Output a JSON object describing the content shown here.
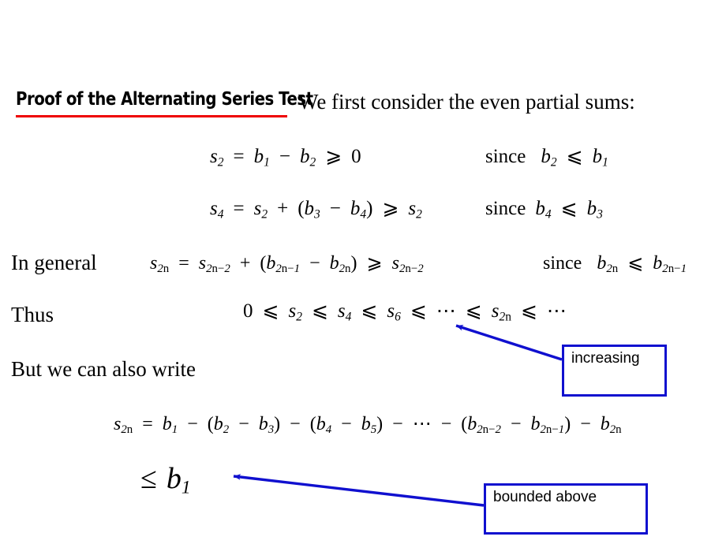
{
  "slide": {
    "title": "Proof of the Alternating Series Test",
    "intro": "We first consider the even partial sums:"
  },
  "lines": {
    "eq1": "s₂ = b₁ − b₂ ⩾ 0",
    "eq1_since": "since  b₂ ⩽ b₁",
    "eq2": "s₄ = s₂ + (b₃ − b₄) ⩾ s₂",
    "eq2_since": "since b₄ ⩽ b₃",
    "in_general_label": "In general",
    "eq3": "s₂ₙ = s₂ₙ₋₂ + (b₂ₙ₋₁ − b₂ₙ) ⩾ s₂ₙ₋₂",
    "eq3_since": "since  b₂ₙ ⩽ b₂ₙ₋₁",
    "thus_label": "Thus",
    "eq4": "0 ⩽ s₂ ⩽ s₄ ⩽ s₆ ⩽ ⋯ ⩽ s₂ₙ ⩽ ⋯",
    "but_label": "But we can also write",
    "eq5": "s₂ₙ = b₁ − (b₂ − b₃) − (b₄ − b₅) − ⋯ − (b₂ₙ₋₂ − b₂ₙ₋₁) − b₂ₙ",
    "eq6": "≤ b₁"
  },
  "callouts": {
    "increasing": "increasing",
    "bounded_above": "bounded above"
  },
  "colors": {
    "title_underline": "#ee0000",
    "callout_border": "#1010cf",
    "arrow": "#1010cf",
    "text": "#000000",
    "background": "#ffffff"
  }
}
